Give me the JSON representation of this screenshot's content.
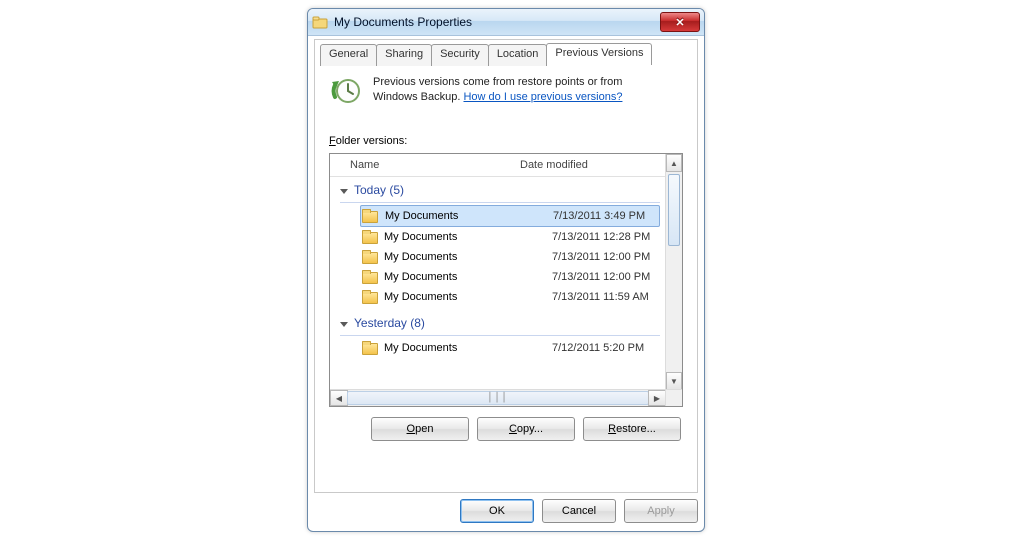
{
  "window": {
    "title": "My Documents Properties"
  },
  "tabs": [
    "General",
    "Sharing",
    "Security",
    "Location",
    "Previous Versions"
  ],
  "active_tab_index": 4,
  "description": {
    "line1": "Previous versions come from restore points or from",
    "line2_prefix": "Windows Backup. ",
    "help_link": "How do I use previous versions?"
  },
  "folder_versions_label_prefix": "F",
  "folder_versions_label_rest": "older versions:",
  "columns": {
    "name": "Name",
    "date": "Date modified"
  },
  "groups": [
    {
      "label": "Today (5)",
      "items": [
        {
          "name": "My Documents",
          "date": "7/13/2011 3:49 PM",
          "selected": true
        },
        {
          "name": "My Documents",
          "date": "7/13/2011 12:28 PM"
        },
        {
          "name": "My Documents",
          "date": "7/13/2011 12:00 PM"
        },
        {
          "name": "My Documents",
          "date": "7/13/2011 12:00 PM"
        },
        {
          "name": "My Documents",
          "date": "7/13/2011 11:59 AM"
        }
      ]
    },
    {
      "label": "Yesterday (8)",
      "items": [
        {
          "name": "My Documents",
          "date": "7/12/2011 5:20 PM"
        }
      ]
    }
  ],
  "action_buttons": {
    "open": "pen",
    "copy": "opy...",
    "restore": "estore..."
  },
  "footer_buttons": {
    "ok": "OK",
    "cancel": "Cancel",
    "apply": "Apply"
  }
}
